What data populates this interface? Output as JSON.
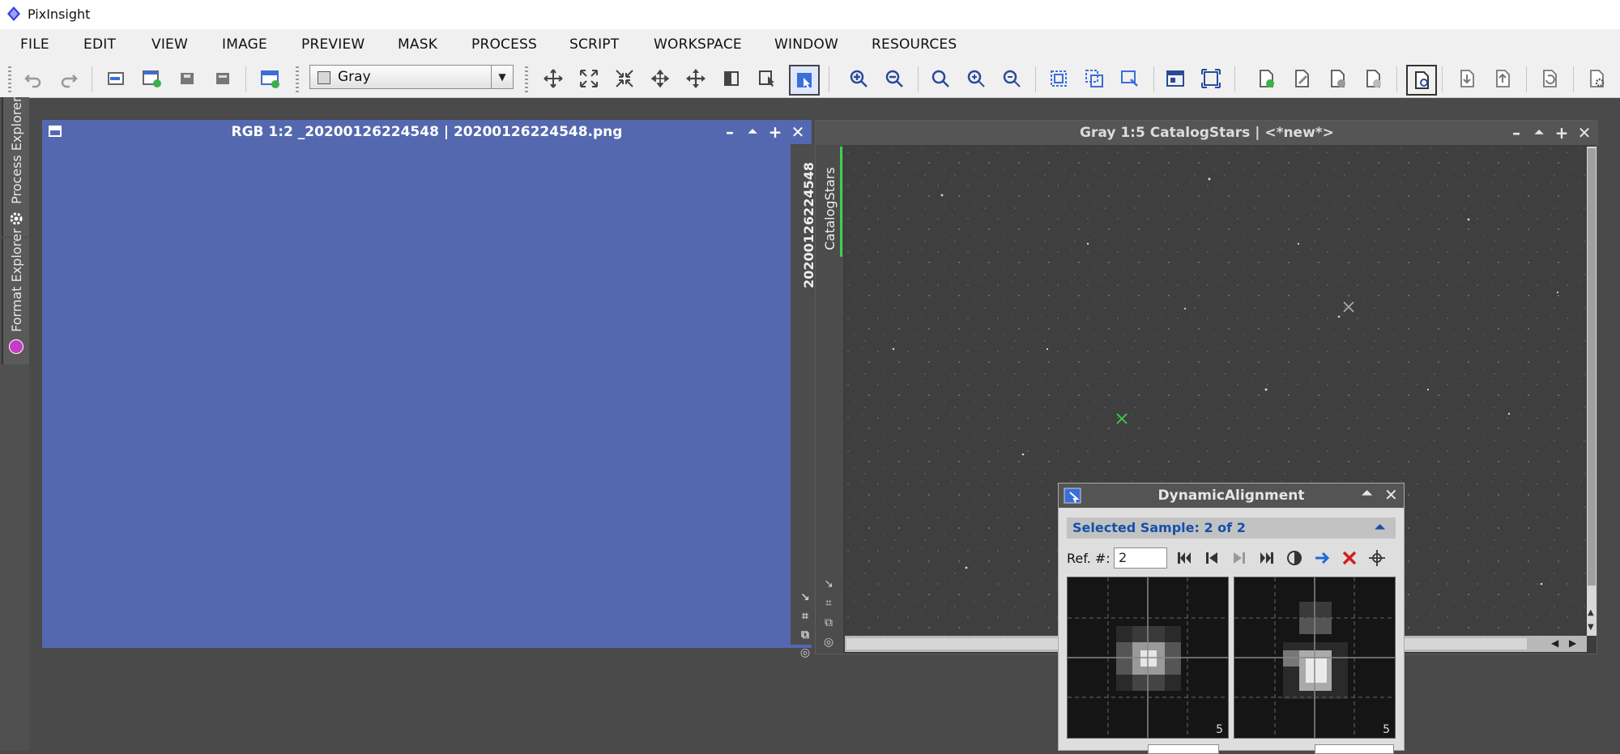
{
  "app": {
    "title": "PixInsight"
  },
  "menu": [
    "FILE",
    "EDIT",
    "VIEW",
    "IMAGE",
    "PREVIEW",
    "MASK",
    "PROCESS",
    "SCRIPT",
    "WORKSPACE",
    "WINDOW",
    "RESOURCES"
  ],
  "toolbar": {
    "combo_value": "Gray"
  },
  "left_dock": {
    "tabs": [
      "Process Explorer",
      "Format Explorer"
    ]
  },
  "image_window_1": {
    "title": "RGB 1:2 _20200126224548 | 20200126224548.png",
    "side_tab": "_20200126224548"
  },
  "image_window_2": {
    "title": "Gray 1:5 CatalogStars | <*new*>",
    "side_tab": "CatalogStars"
  },
  "dynamic_alignment": {
    "title": "DynamicAlignment",
    "selected_sample": "Selected Sample: 2 of 2",
    "ref_label": "Ref. #:",
    "ref_value": "2",
    "zoom_left_label": "5",
    "zoom_right_label": "5"
  },
  "colors": {
    "active_title": "#5468b0",
    "inactive_title": "#555555",
    "accent_blue": "#1550a8"
  }
}
